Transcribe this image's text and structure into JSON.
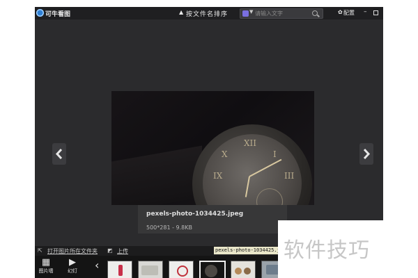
{
  "titlebar": {
    "app_title": "可牛看图",
    "sort_label": "按文件名排序",
    "search_placeholder": "请输入文字",
    "settings_label": "配置"
  },
  "viewer": {
    "file_name": "pexels-photo-1034425.jpeg",
    "file_meta": "500*281 - 9.8KB"
  },
  "actionbar": {
    "open_folder_label": "打开图片所在文件夹",
    "upload_label": "上传",
    "tooltip_filename": "pexels-photo-1034425.jpeg"
  },
  "filmstrip": {
    "grid_label": "图片墙",
    "slideshow_label": "幻灯"
  },
  "watermark": {
    "text": "软件技巧"
  },
  "colors": {
    "window_bg": "#2b2b2d",
    "titlebar_bg": "#1f1f21",
    "tooltip_bg": "#e9e6c9"
  }
}
